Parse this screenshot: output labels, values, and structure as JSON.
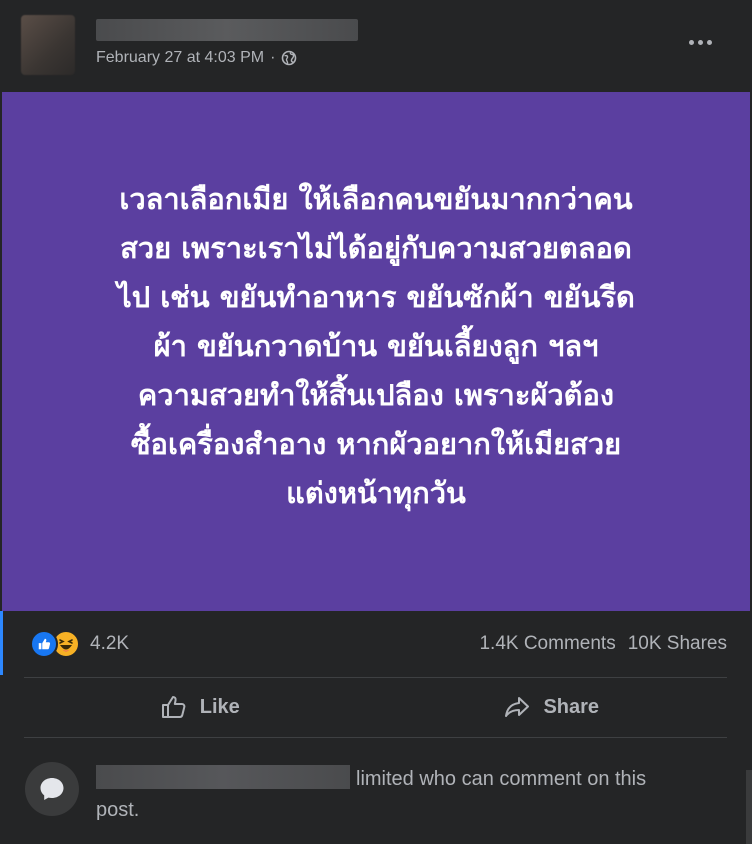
{
  "post": {
    "author_name_redacted": true,
    "timestamp": "February 27 at 4:03 PM",
    "separator": "·",
    "privacy_icon": "globe-icon",
    "text_lines": [
      "เวลาเลือกเมีย ให้เลือกคนขยันมากกว่าคน",
      "สวย เพราะเราไม่ได้อยู่กับความสวยตลอด",
      "ไป เช่น ขยันทำอาหาร ขยันซักผ้า ขยันรีด",
      "ผ้า ขยันกวาดบ้าน ขยันเลี้ยงลูก ฯลฯ",
      "ความสวยทำให้สิ้นเปลือง เพราะผัวต้อง",
      "ซื้อเครื่องสำอาง หากผัวอยากให้เมียสวย",
      "แต่งหน้าทุกวัน"
    ],
    "background_color": "#5b3fa0"
  },
  "stats": {
    "reaction_count": "4.2K",
    "comments": "1.4K Comments",
    "shares": "10K Shares",
    "reaction_icons": [
      "like-icon",
      "haha-icon"
    ]
  },
  "actions": {
    "like_label": "Like",
    "share_label": "Share"
  },
  "notice": {
    "text_part1": "limited who can comment on this",
    "text_part2": "post."
  },
  "colors": {
    "accent": "#2d88ff",
    "card_bg": "#242526"
  }
}
